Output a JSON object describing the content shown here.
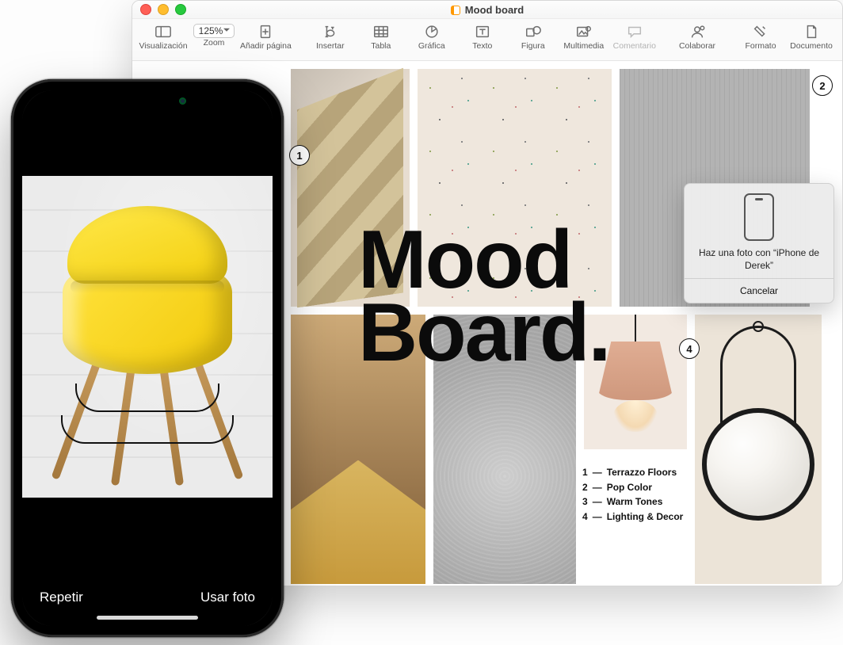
{
  "window": {
    "title": "Mood board"
  },
  "toolbar": {
    "view": "Visualización",
    "zoom_value": "125%",
    "zoom_label": "Zoom",
    "add_page": "Añadir página",
    "insert": "Insertar",
    "table": "Tabla",
    "chart": "Gráfica",
    "text": "Texto",
    "shape": "Figura",
    "media": "Multimedia",
    "comment": "Comentario",
    "collab": "Colaborar",
    "format": "Formato",
    "document": "Documento"
  },
  "doc": {
    "headline_l1": "Mood",
    "headline_l2": "Board.",
    "markers": {
      "m1": "1",
      "m2": "2",
      "m4": "4"
    },
    "legend": [
      {
        "n": "1",
        "txt": "Terrazzo Floors"
      },
      {
        "n": "2",
        "txt": "Pop Color"
      },
      {
        "n": "3",
        "txt": "Warm Tones"
      },
      {
        "n": "4",
        "txt": "Lighting & Decor"
      }
    ]
  },
  "popover": {
    "message": "Haz una foto con “iPhone de Derek”",
    "cancel": "Cancelar"
  },
  "iphone": {
    "retake": "Repetir",
    "use": "Usar foto"
  }
}
